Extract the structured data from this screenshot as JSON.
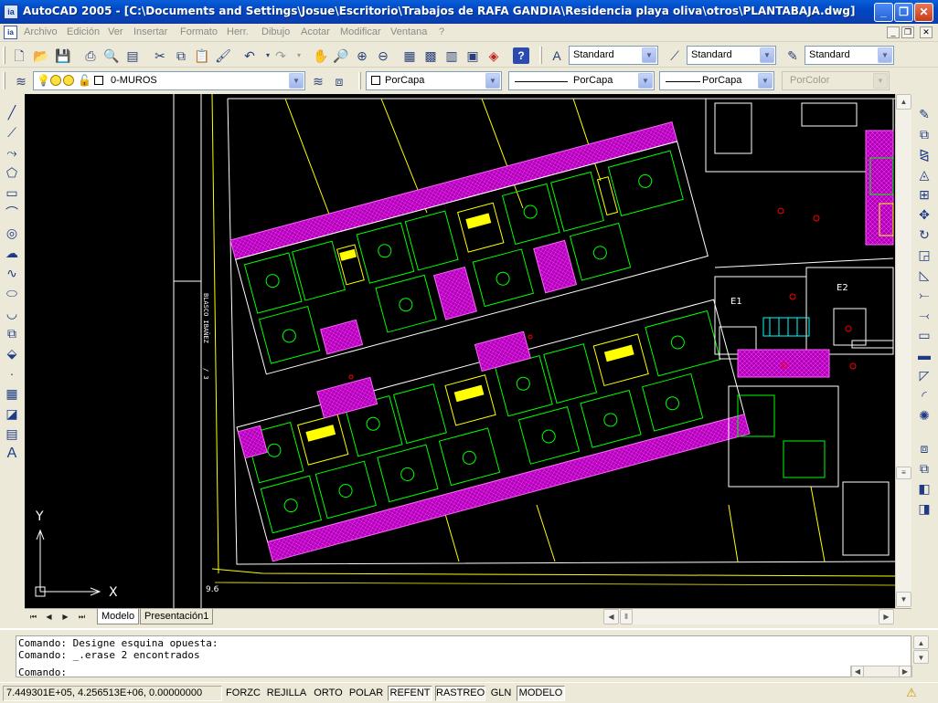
{
  "window": {
    "title": "AutoCAD 2005 - [C:\\Documents and Settings\\Josue\\Escritorio\\Trabajos de RAFA GANDIA\\Residencia playa oliva\\otros\\PLANTABAJA.dwg]",
    "minimize": "_",
    "maximize": "❐",
    "close": "✕"
  },
  "menu": [
    "Archivo",
    "Edición",
    "Ver",
    "Insertar",
    "Formato",
    "Herr.",
    "Dibujo",
    "Acotar",
    "Modificar",
    "Ventana",
    "?"
  ],
  "styles": {
    "text_style": "Standard",
    "dim_style": "Standard",
    "table_style": "Standard"
  },
  "layers": {
    "current_layer": "0-MUROS",
    "color": "PorCapa",
    "linetype": "PorCapa",
    "lineweight": "PorCapa",
    "plotstyle": "PorColor"
  },
  "drawing": {
    "ucs_x": "X",
    "ucs_y": "Y",
    "street_label": "BLASCO IBAÑEZ",
    "street_number": "/ 3",
    "elevation_label": "9.6",
    "room_e1": "E1",
    "room_e2": "E2"
  },
  "tabs": {
    "model": "Modelo",
    "layout1": "Presentación1"
  },
  "command": {
    "line1": "Comando: Designe esquina opuesta:",
    "line2": "Comando: _.erase 2 encontrados",
    "prompt": "Comando:"
  },
  "status": {
    "coords": "7.449301E+05, 4.256513E+06, 0.00000000",
    "buttons": [
      "FORZC",
      "REJILLA",
      "ORTO",
      "POLAR",
      "REFENT",
      "RASTREO",
      "GLN",
      "MODELO"
    ],
    "active": [
      "REFENT",
      "RASTREO",
      "MODELO"
    ]
  },
  "colors": {
    "titlebar": "#0a5fd8",
    "canvas_bg": "#000000",
    "walls": "#00ff00",
    "hatch": "#c000c0",
    "outline": "#ffffff",
    "accent_yellow": "#ffff00",
    "accent_red": "#ff0000",
    "accent_cyan": "#00ffff"
  },
  "icons": {
    "draw_tools": [
      "line-icon",
      "construction-line-icon",
      "polyline-icon",
      "polygon-icon",
      "rectangle-icon",
      "arc-icon",
      "circle-icon",
      "revision-cloud-icon",
      "spline-icon",
      "ellipse-icon",
      "ellipse-arc-icon",
      "insert-block-icon",
      "make-block-icon",
      "point-icon",
      "hatch-icon",
      "region-icon",
      "table-icon",
      "mtext-icon"
    ],
    "modify_tools": [
      "erase-icon",
      "copy-icon",
      "mirror-icon",
      "offset-icon",
      "array-icon",
      "move-icon",
      "rotate-icon",
      "scale-icon",
      "stretch-icon",
      "trim-icon",
      "extend-icon",
      "break-icon",
      "join-icon",
      "chamfer-icon",
      "fillet-icon",
      "explode-icon"
    ]
  }
}
